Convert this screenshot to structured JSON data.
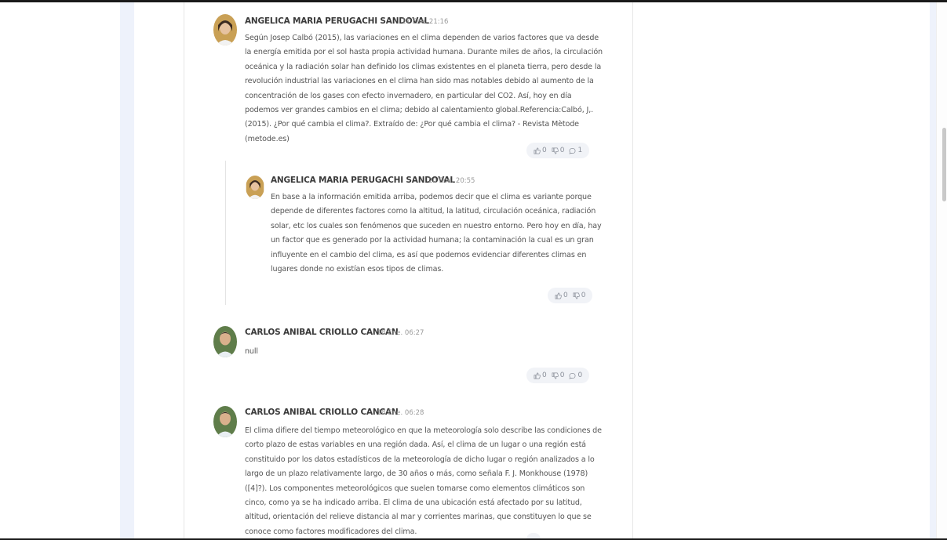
{
  "comments": [
    {
      "author": "ANGELICA MARIA PERUGACHI SANDOVAL",
      "date": "17 Ene. 21:16",
      "text": "Según Josep Calbó (2015), las variaciones en el clima dependen de varios factores que va desde la energía emitida por el sol hasta propia actividad humana. Durante miles de años, la circulación oceánica y la radiación solar han definido los climas existentes en el planeta tierra, pero desde la revolución industrial las variaciones en el clima han sido mas notables debido al aumento de la concentración de los gases con efecto invernadero, en particular del CO2. Así, hoy en día podemos ver grandes cambios en el clima; debido al calentamiento global.Referencia:Calbó, J,. (2015). ¿Por qué cambia el clima?. Extraído de: ¿Por qué cambia el clima? - Revista Mètode (metode.es)",
      "likes": "0",
      "dislikes": "0",
      "replies": "1"
    },
    {
      "author": "ANGELICA MARIA PERUGACHI SANDOVAL",
      "date": "20 Ene. 20:55",
      "text": "En base a la información emitida arriba, podemos decir que el clima es variante porque depende de diferentes factores como la altitud, la latitud, circulación oceánica, radiación solar, etc los cuales son fenómenos que suceden en nuestro entorno. Pero hoy en día, hay un factor que es generado por la actividad humana; la contaminación la cual es un gran influyente en el cambio del clima, es así que podemos evidenciar diferentes climas en lugares donde no existían esos tipos de climas.",
      "likes": "0",
      "dislikes": "0"
    },
    {
      "author": "CARLOS ANIBAL CRIOLLO CANCAN",
      "date": "18 Ene. 06:27",
      "text": "null",
      "likes": "0",
      "dislikes": "0",
      "replies": "0"
    },
    {
      "author": "CARLOS ANIBAL CRIOLLO CANCAN",
      "date": "18 Ene. 06:28",
      "text": "El clima difiere del tiempo meteorológico en que la meteorología solo describe las condiciones de corto plazo de estas variables en una región dada. Así, el clima de un lugar o una región está constituido por los datos estadísticos de la meteorología de dicho lugar o región analizados a lo largo de un plazo relativamente largo, de 30 años o más, como señala F. J. Monkhouse (1978) ([4]?). Los componentes meteorológicos que suelen tomarse como elementos climáticos son cinco, como ya se ha indicado arriba. El clima de una ubicación está afectado por su latitud, altitud, orientación del relieve distancia al mar y corrientes marinas, que constituyen lo que se conoce como factores modificadores del clima."
    }
  ],
  "colors": {
    "accent": "#f1f3f7",
    "text": "#555555",
    "name": "#3a3a3a"
  },
  "icons": {
    "like": "thumbs-up-icon",
    "dislike": "thumbs-down-icon",
    "reply": "comment-bubble-icon"
  }
}
